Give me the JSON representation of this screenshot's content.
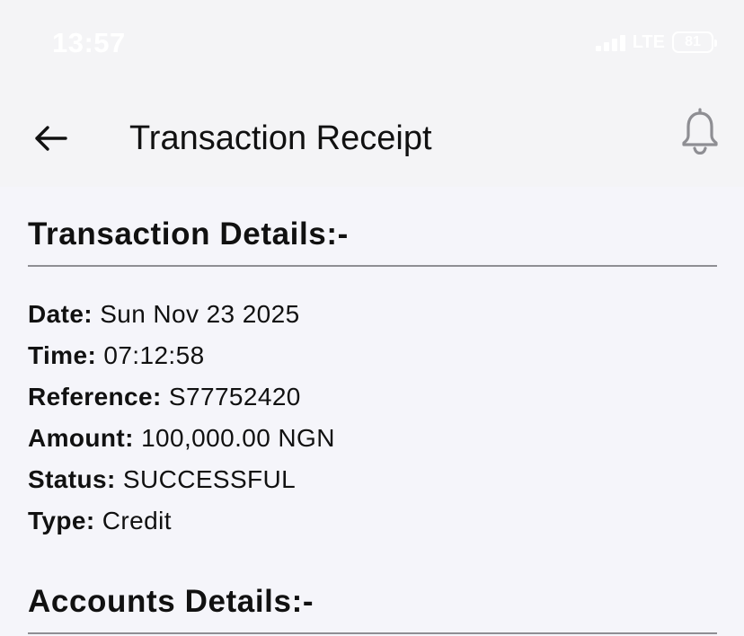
{
  "status_bar": {
    "time": "13:57",
    "network": "LTE",
    "battery": "81"
  },
  "header": {
    "title": "Transaction Receipt",
    "back_icon": "arrow-left-icon",
    "notification_icon": "bell-icon"
  },
  "transaction_details": {
    "title": "Transaction Details:-",
    "rows": [
      {
        "label": "Date:",
        "value": "Sun Nov 23 2025"
      },
      {
        "label": "Time:",
        "value": "07:12:58"
      },
      {
        "label": "Reference:",
        "value": "S77752420"
      },
      {
        "label": "Amount:",
        "value": "100,000.00 NGN"
      },
      {
        "label": "Status:",
        "value": "SUCCESSFUL"
      },
      {
        "label": "Type:",
        "value": "Credit"
      }
    ]
  },
  "accounts_details": {
    "title": "Accounts Details:-"
  },
  "colors": {
    "header_background": "#f4f4f6",
    "page_background": "#f5f5fa",
    "divider": "#8e8e93",
    "icon_gray": "#8e8e93",
    "text": "#111111"
  }
}
